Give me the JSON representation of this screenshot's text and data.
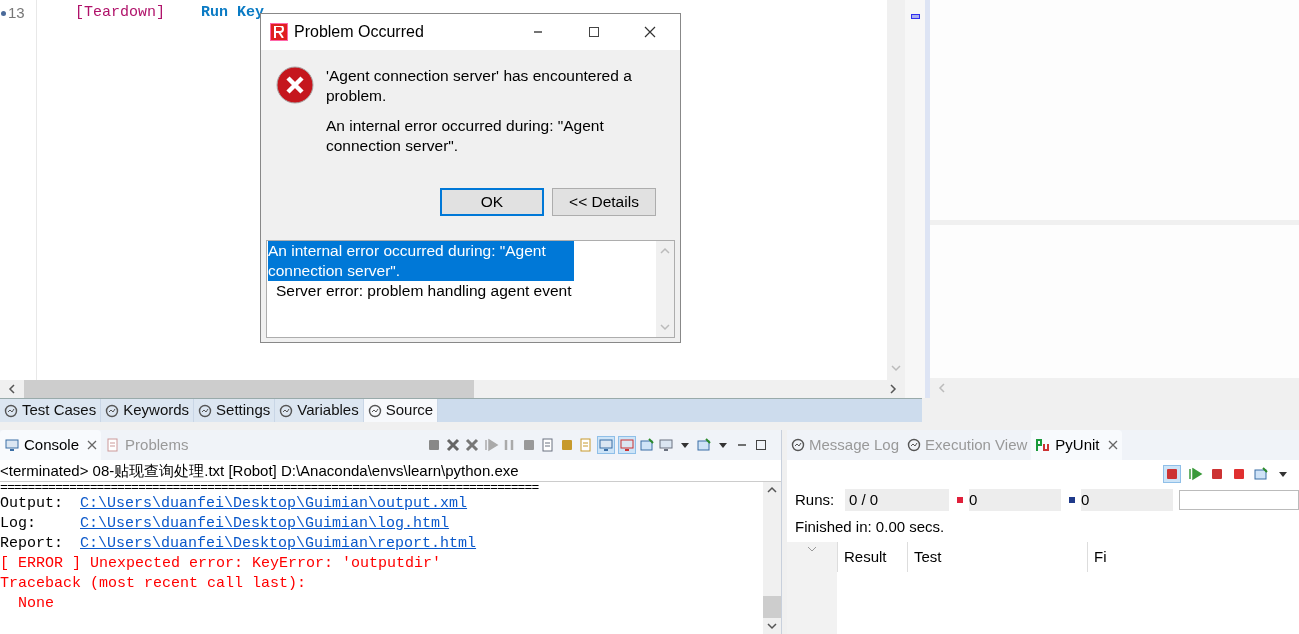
{
  "editor": {
    "lines": [
      {
        "number": "13",
        "cells": [
          {
            "kind": "setting",
            "text": "[Teardown]"
          },
          {
            "kind": "keyword",
            "text": "Run Key"
          }
        ]
      }
    ]
  },
  "editor_tabs": [
    {
      "label": "Test Cases",
      "selected": false
    },
    {
      "label": "Keywords",
      "selected": false
    },
    {
      "label": "Settings",
      "selected": false
    },
    {
      "label": "Variables",
      "selected": false
    },
    {
      "label": "Source",
      "selected": true
    }
  ],
  "console": {
    "tabs": [
      {
        "label": "Console",
        "selected": true
      },
      {
        "label": "Problems",
        "selected": false
      }
    ],
    "header": "<terminated> 08-贴现查询处理.txt [Robot] D:\\Anaconda\\envs\\learn\\python.exe",
    "separator": "==============================================================================",
    "lines": [
      {
        "kind": "link",
        "label": "Output:",
        "text": "C:\\Users\\duanfei\\Desktop\\Guimian\\output.xml"
      },
      {
        "kind": "link",
        "label": "Log:",
        "text": "C:\\Users\\duanfei\\Desktop\\Guimian\\log.html"
      },
      {
        "kind": "link",
        "label": "Report:",
        "text": "C:\\Users\\duanfei\\Desktop\\Guimian\\report.html"
      },
      {
        "kind": "error",
        "text": "[ ERROR ] Unexpected error: KeyError: 'outputdir'"
      },
      {
        "kind": "error",
        "text": "Traceback (most recent call last):"
      },
      {
        "kind": "error",
        "text": "  None"
      }
    ]
  },
  "pyunit": {
    "tabs": [
      {
        "label": "Message Log",
        "selected": false
      },
      {
        "label": "Execution View",
        "selected": false
      },
      {
        "label": "PyUnit",
        "selected": true
      }
    ],
    "runs_label": "Runs:",
    "runs": "0 / 0",
    "errors": "0",
    "failures": "0",
    "progress": {
      "level": 0
    },
    "finished": "Finished in: 0.00 secs.",
    "columns": [
      "Result",
      "Test",
      "Fi"
    ]
  },
  "dialog": {
    "title": "Problem Occurred",
    "message": "'Agent connection server' has encountered a problem.",
    "reason": "An internal error occurred during: \"Agent connection server\".",
    "buttons": [
      {
        "label": "OK",
        "default": true
      },
      {
        "label": "<< Details",
        "default": false
      }
    ],
    "details": {
      "selected_text": "An internal error occurred during: \"Agent connection server\".",
      "text": "Server error: problem handling agent event"
    }
  }
}
